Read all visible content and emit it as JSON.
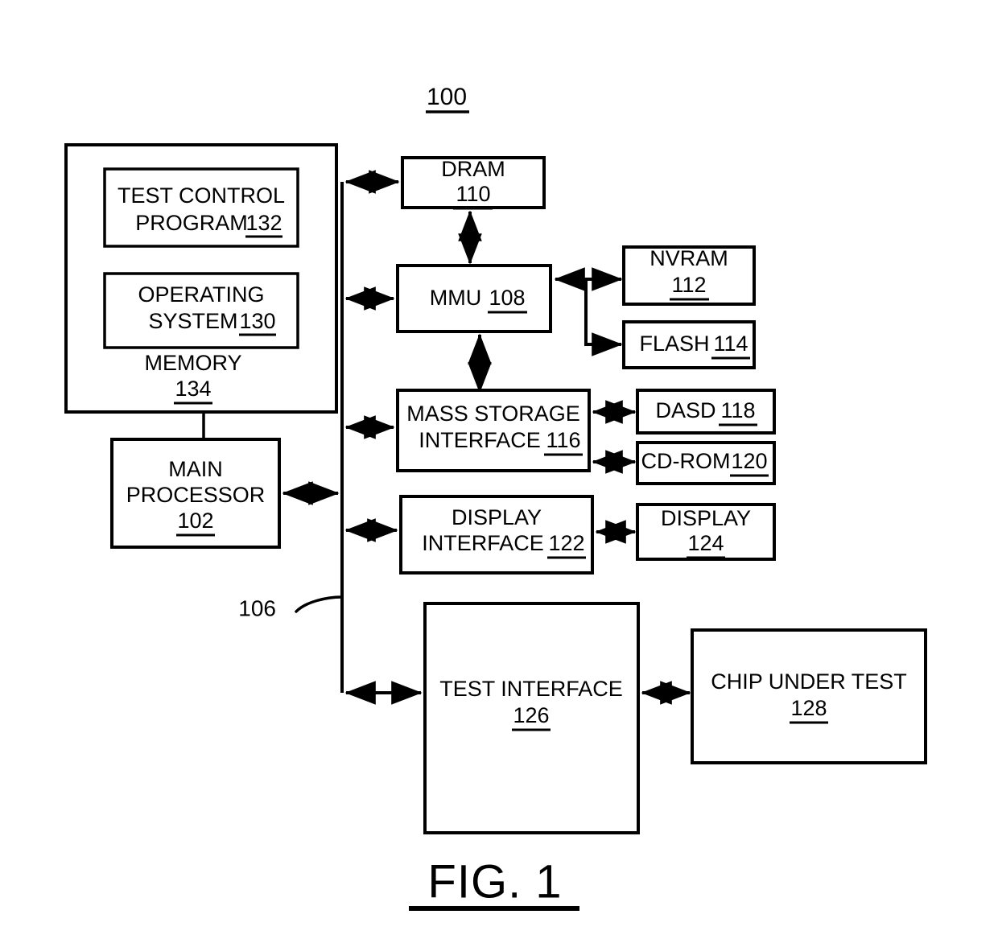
{
  "figure": {
    "top_reference": "100",
    "caption": "FIG. 1",
    "bus_reference": "106"
  },
  "blocks": {
    "memory": {
      "label": "MEMORY",
      "ref": "134"
    },
    "test_control_program": {
      "label": "TEST CONTROL",
      "label2": "PROGRAM",
      "ref": "132"
    },
    "operating_system": {
      "label": "OPERATING",
      "label2": "SYSTEM",
      "ref": "130"
    },
    "main_processor": {
      "label": "MAIN",
      "label2": "PROCESSOR",
      "ref": "102"
    },
    "dram": {
      "label": "DRAM",
      "ref": "110"
    },
    "mmu": {
      "label": "MMU",
      "ref": "108"
    },
    "nvram": {
      "label": "NVRAM",
      "ref": "112"
    },
    "flash": {
      "label": "FLASH",
      "ref": "114"
    },
    "mass_storage_interface": {
      "label": "MASS STORAGE",
      "label2": "INTERFACE",
      "ref": "116"
    },
    "dasd": {
      "label": "DASD",
      "ref": "118"
    },
    "cdrom": {
      "label": "CD-ROM",
      "ref": "120"
    },
    "display_interface": {
      "label": "DISPLAY",
      "label2": "INTERFACE",
      "ref": "122"
    },
    "display": {
      "label": "DISPLAY",
      "ref": "124"
    },
    "test_interface": {
      "label": "TEST INTERFACE",
      "ref": "126"
    },
    "chip_under_test": {
      "label": "CHIP  UNDER TEST",
      "ref": "128"
    }
  },
  "colors": {
    "ink": "#000000",
    "paper": "#ffffff"
  }
}
